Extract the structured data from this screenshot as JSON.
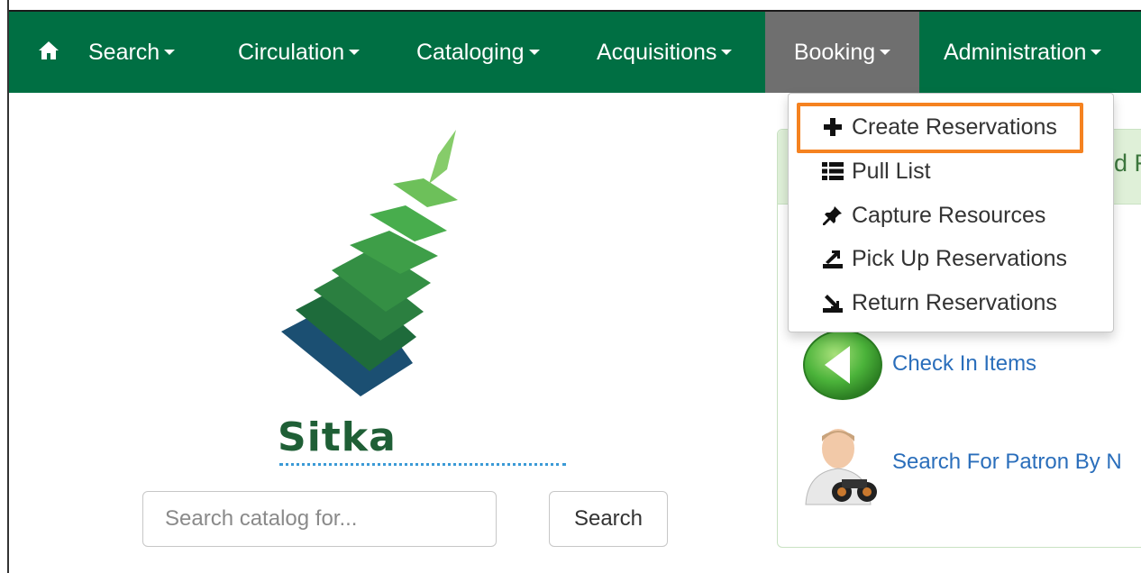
{
  "navbar": {
    "items": [
      {
        "label": "Search"
      },
      {
        "label": "Circulation"
      },
      {
        "label": "Cataloging"
      },
      {
        "label": "Acquisitions"
      },
      {
        "label": "Booking"
      },
      {
        "label": "Administration"
      }
    ],
    "active": "Booking",
    "color": "#006f43"
  },
  "booking_menu": {
    "items": [
      {
        "label": "Create Reservations",
        "icon": "plus-icon"
      },
      {
        "label": "Pull List",
        "icon": "list-icon"
      },
      {
        "label": "Capture Resources",
        "icon": "pushpin-icon"
      },
      {
        "label": "Pick Up Reservations",
        "icon": "pickup-icon"
      },
      {
        "label": "Return Reservations",
        "icon": "return-icon"
      }
    ],
    "highlighted": "Create Reservations",
    "highlight_color": "#f58220"
  },
  "panel": {
    "header_fragment": "d F",
    "links": [
      {
        "label": "Check In Items",
        "icon": "green-back-arrow-icon"
      },
      {
        "label": "Search For Patron By N",
        "icon": "patron-binoculars-icon"
      }
    ]
  },
  "logo": {
    "text": "Sitka"
  },
  "search": {
    "placeholder": "Search catalog for...",
    "button_label": "Search"
  }
}
